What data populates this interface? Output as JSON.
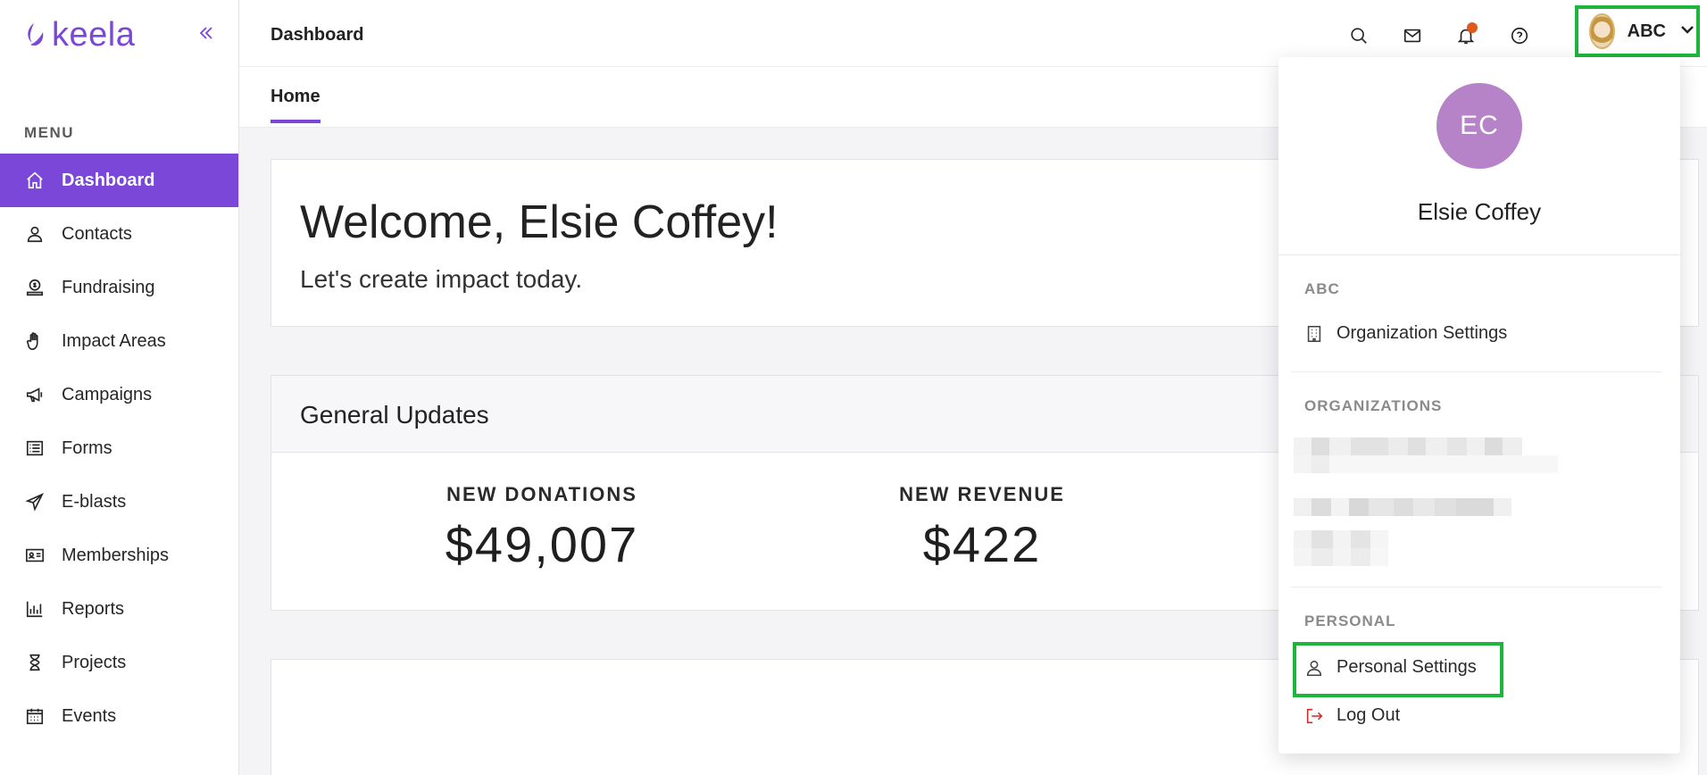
{
  "brand": {
    "name": "keela",
    "color": "#7b47d8"
  },
  "sidebar": {
    "menu_label": "MENU",
    "items": [
      {
        "label": "Dashboard",
        "icon": "home-icon",
        "active": true
      },
      {
        "label": "Contacts",
        "icon": "person-icon"
      },
      {
        "label": "Fundraising",
        "icon": "donation-icon"
      },
      {
        "label": "Impact Areas",
        "icon": "hand-icon"
      },
      {
        "label": "Campaigns",
        "icon": "megaphone-icon"
      },
      {
        "label": "Forms",
        "icon": "list-icon"
      },
      {
        "label": "E-blasts",
        "icon": "paper-plane-icon"
      },
      {
        "label": "Memberships",
        "icon": "id-card-icon"
      },
      {
        "label": "Reports",
        "icon": "bar-chart-icon"
      },
      {
        "label": "Projects",
        "icon": "hourglass-icon"
      },
      {
        "label": "Events",
        "icon": "calendar-icon"
      }
    ]
  },
  "header": {
    "title": "Dashboard",
    "account_label": "ABC",
    "notification_dot_color": "#e0581c",
    "highlight_color": "#1db53b"
  },
  "tabs": [
    {
      "label": "Home",
      "active": true
    }
  ],
  "welcome": {
    "title": "Welcome, Elsie Coffey!",
    "subtitle": "Let's create impact today."
  },
  "updates": {
    "title": "General Updates",
    "stats": [
      {
        "label": "NEW DONATIONS",
        "value": "$49,007"
      },
      {
        "label": "NEW REVENUE",
        "value": "$422"
      }
    ]
  },
  "account_menu": {
    "initials": "EC",
    "avatar_color": "#b682c8",
    "name": "Elsie Coffey",
    "current_org_section": "ABC",
    "org_settings_label": "Organization Settings",
    "organizations_section": "ORGANIZATIONS",
    "personal_section": "PERSONAL",
    "personal_settings_label": "Personal Settings",
    "logout_label": "Log Out"
  }
}
